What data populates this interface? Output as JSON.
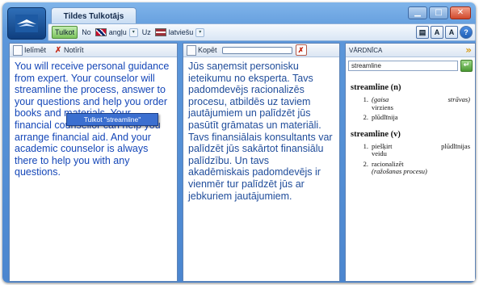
{
  "window": {
    "title": "Tildes Tulkotājs",
    "min_glyph": "▁",
    "max_glyph": "□",
    "close_glyph": "✕"
  },
  "toolbar": {
    "translate_button": "Tulkot",
    "from_label": "No",
    "from_language": "angļu",
    "to_label": "Uz",
    "to_language": "latviešu",
    "dropdown_arrow": "▾",
    "icons": {
      "view": "▤",
      "font_a1": "A",
      "font_a2": "A",
      "help": "?"
    }
  },
  "source_pane": {
    "insert_label": "Ielīmēt",
    "clear_label": "Notīrīt",
    "text": "You will receive personal guidance from expert. Your counselor will streamline the process, answer to your questions and help you order books and materials. Your financial counsellor can help you arrange financial aid. And your academic counselor is always there to help you with any questions.",
    "context_menu": "Tulkot \"streamline\""
  },
  "target_pane": {
    "copy_label": "Kopēt",
    "clear_glyph": "✗",
    "text": "Jūs saņemsit personisku ieteikumu no eksperta. Tavs padomdevējs racionalizēs procesu, atbildēs uz taviem jautājumiem un palīdzēt jūs pasūtīt grāmatas un materiāli. Tavs finansiālais konsultants var palīdzēt jūs sakārtot finansiālu palīdzību. Un tavs akadēmiskais padomdevējs ir vienmēr tur palīdzēt jūs ar jebkuriem jautājumiem."
  },
  "dictionary": {
    "title": "VĀRDNĪCA",
    "forward_glyph": "»",
    "search_value": "streamline",
    "go_glyph": "↵",
    "entries": [
      {
        "head": "streamline (n)",
        "senses": [
          {
            "num": "1.",
            "text": "(gaisa",
            "text_right": "strāvas)",
            "text2": "virziens",
            "italic": true
          },
          {
            "num": "2.",
            "text": "plūdlīnija"
          }
        ]
      },
      {
        "head": "streamline (v)",
        "senses": [
          {
            "num": "1.",
            "text": "piešķirt",
            "text_right": "plūdlīnijas",
            "text2": "veidu"
          },
          {
            "num": "2.",
            "text": "racionalizēt",
            "text2": "(ražošanas procesu)",
            "italic2": true
          }
        ]
      }
    ]
  }
}
